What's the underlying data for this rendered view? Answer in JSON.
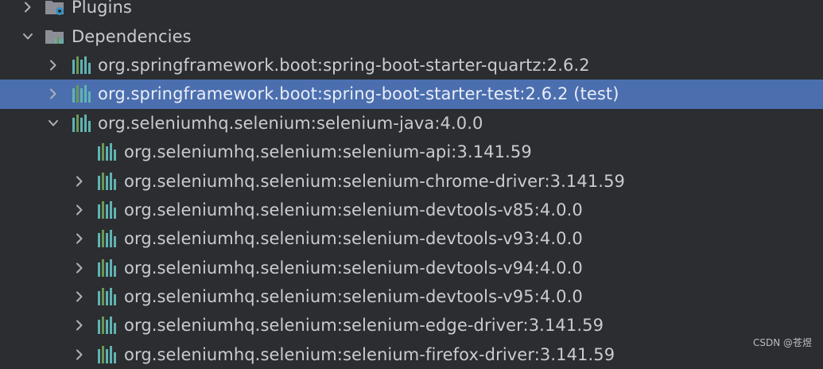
{
  "tree": {
    "rows": [
      {
        "label": "Plugins",
        "level": 0,
        "expanded": false,
        "has_arrow": true,
        "icon": "plugins-folder-icon"
      },
      {
        "label": "Dependencies",
        "level": 0,
        "expanded": true,
        "has_arrow": true,
        "icon": "dependencies-folder-icon"
      },
      {
        "label": "org.springframework.boot:spring-boot-starter-quartz:2.6.2",
        "level": 1,
        "expanded": false,
        "has_arrow": true,
        "icon": "library-icon"
      },
      {
        "label": "org.springframework.boot:spring-boot-starter-test:2.6.2 (test)",
        "level": 1,
        "expanded": false,
        "has_arrow": true,
        "icon": "library-icon",
        "selected": true
      },
      {
        "label": "org.seleniumhq.selenium:selenium-java:4.0.0",
        "level": 1,
        "expanded": true,
        "has_arrow": true,
        "icon": "library-icon"
      },
      {
        "label": "org.seleniumhq.selenium:selenium-api:3.141.59",
        "level": 2,
        "expanded": false,
        "has_arrow": false,
        "icon": "library-icon"
      },
      {
        "label": "org.seleniumhq.selenium:selenium-chrome-driver:3.141.59",
        "level": 2,
        "expanded": false,
        "has_arrow": true,
        "icon": "library-icon"
      },
      {
        "label": "org.seleniumhq.selenium:selenium-devtools-v85:4.0.0",
        "level": 2,
        "expanded": false,
        "has_arrow": true,
        "icon": "library-icon"
      },
      {
        "label": "org.seleniumhq.selenium:selenium-devtools-v93:4.0.0",
        "level": 2,
        "expanded": false,
        "has_arrow": true,
        "icon": "library-icon"
      },
      {
        "label": "org.seleniumhq.selenium:selenium-devtools-v94:4.0.0",
        "level": 2,
        "expanded": false,
        "has_arrow": true,
        "icon": "library-icon"
      },
      {
        "label": "org.seleniumhq.selenium:selenium-devtools-v95:4.0.0",
        "level": 2,
        "expanded": false,
        "has_arrow": true,
        "icon": "library-icon"
      },
      {
        "label": "org.seleniumhq.selenium:selenium-edge-driver:3.141.59",
        "level": 2,
        "expanded": false,
        "has_arrow": true,
        "icon": "library-icon"
      },
      {
        "label": "org.seleniumhq.selenium:selenium-firefox-driver:3.141.59",
        "level": 2,
        "expanded": false,
        "has_arrow": true,
        "icon": "library-icon"
      }
    ]
  },
  "watermark": "CSDN @苍煜",
  "colors": {
    "background": "#2b2d30",
    "selection": "#4b6eaf",
    "text": "#c8ccd1",
    "library_icon_teal": "#5fb3b3",
    "library_icon_green": "#6a9955"
  }
}
